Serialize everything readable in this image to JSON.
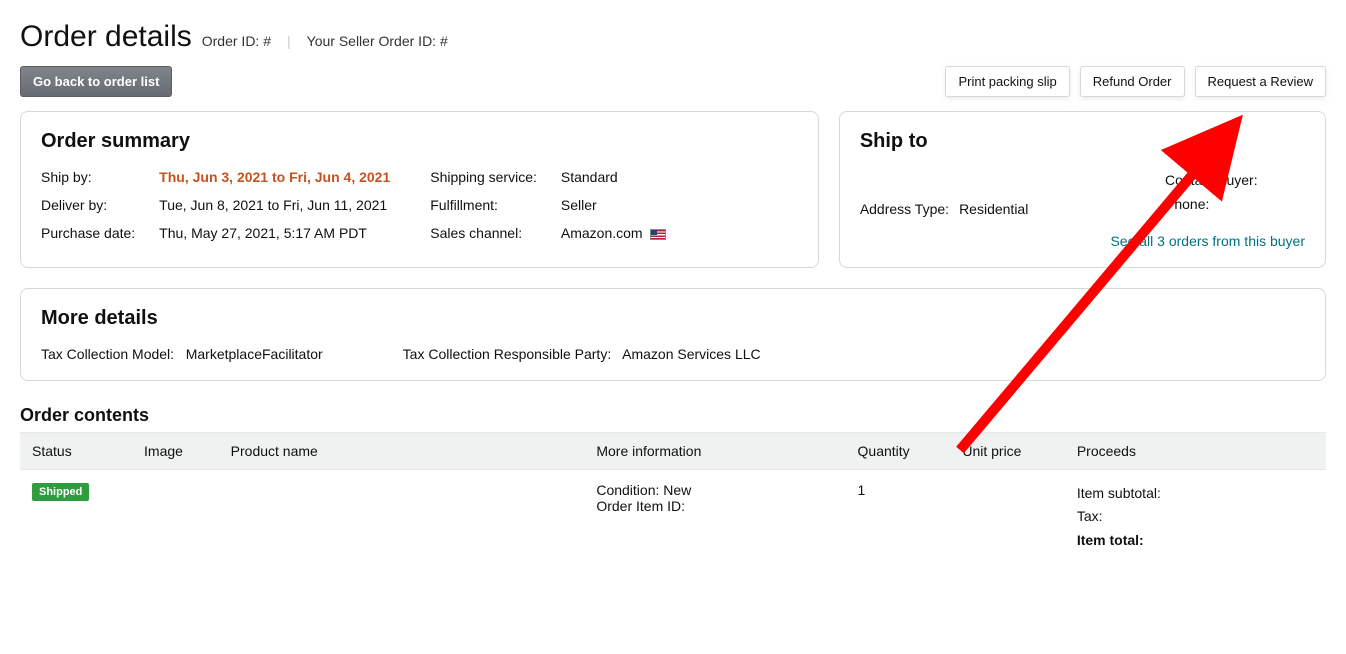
{
  "header": {
    "title": "Order details",
    "order_id_label": "Order ID: #",
    "seller_order_id_label": "Your Seller Order ID: #"
  },
  "toolbar": {
    "back_label": "Go back to order list",
    "print_label": "Print packing slip",
    "refund_label": "Refund Order",
    "request_review_label": "Request a Review"
  },
  "summary": {
    "heading": "Order summary",
    "ship_by_label": "Ship by:",
    "ship_by_value": "Thu, Jun 3, 2021 to Fri, Jun 4, 2021",
    "deliver_by_label": "Deliver by:",
    "deliver_by_value": "Tue, Jun 8, 2021 to Fri, Jun 11, 2021",
    "purchase_date_label": "Purchase date:",
    "purchase_date_value": "Thu, May 27, 2021, 5:17 AM PDT",
    "shipping_service_label": "Shipping service:",
    "shipping_service_value": "Standard",
    "fulfillment_label": "Fulfillment:",
    "fulfillment_value": "Seller",
    "sales_channel_label": "Sales channel:",
    "sales_channel_value": "Amazon.com"
  },
  "shipto": {
    "heading": "Ship to",
    "address_type_label": "Address Type:",
    "address_type_value": "Residential",
    "contact_buyer_label": "Contact Buyer:",
    "phone_label": "Phone:",
    "see_all_link": "See all 3 orders from this buyer"
  },
  "more": {
    "heading": "More details",
    "tax_model_label": "Tax Collection Model:",
    "tax_model_value": "MarketplaceFacilitator",
    "tax_party_label": "Tax Collection Responsible Party:",
    "tax_party_value": "Amazon Services LLC"
  },
  "contents": {
    "heading": "Order contents",
    "columns": {
      "status": "Status",
      "image": "Image",
      "product_name": "Product name",
      "more_info": "More information",
      "quantity": "Quantity",
      "unit_price": "Unit price",
      "proceeds": "Proceeds"
    },
    "row": {
      "status_badge": "Shipped",
      "condition_label": "Condition: New",
      "order_item_id_label": "Order Item ID:",
      "quantity": "1",
      "item_subtotal_label": "Item subtotal:",
      "tax_label": "Tax:",
      "item_total_label": "Item total:"
    }
  }
}
